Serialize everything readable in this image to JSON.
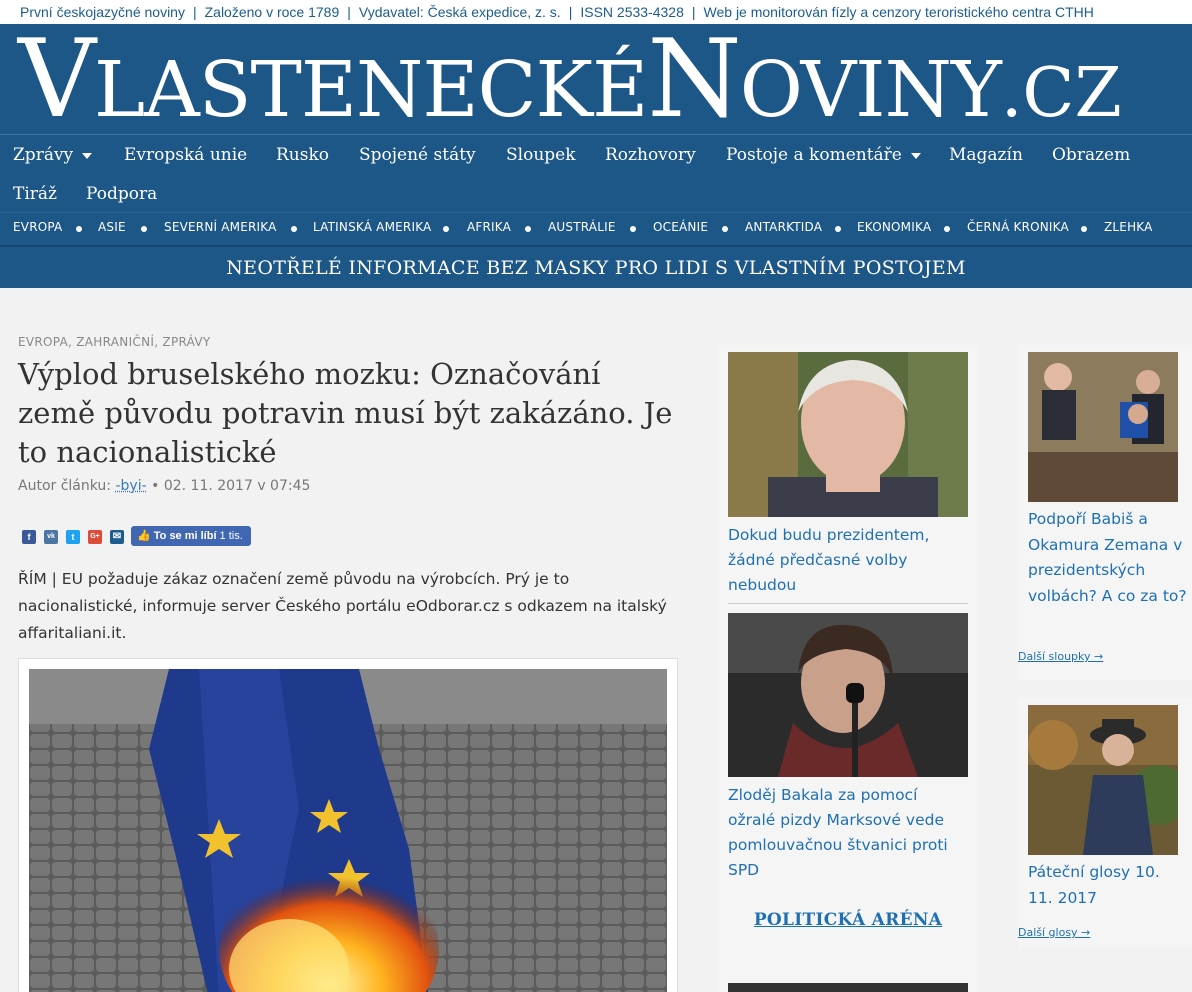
{
  "topbar": {
    "items": [
      "První českojazyčné noviny",
      "Založeno v roce 1789",
      "Vydavatel: Česká expedice, z. s.",
      "ISSN 2533-4328",
      "Web je monitorován fízly a cenzory teroristického centra CTHH"
    ],
    "separator": "|"
  },
  "logo": {
    "v": "V",
    "lastenecke": "LASTENECKÉ",
    "n": "N",
    "oviny": "OVINY",
    "cz": ".CZ"
  },
  "mainnav": {
    "items": [
      {
        "label": "Zprávy",
        "dropdown": true
      },
      {
        "label": "Evropská unie"
      },
      {
        "label": "Rusko"
      },
      {
        "label": "Spojené státy"
      },
      {
        "label": "Sloupek"
      },
      {
        "label": "Rozhovory"
      },
      {
        "label": "Postoje a komentáře",
        "dropdown": true
      },
      {
        "label": "Magazín"
      },
      {
        "label": "Obrazem"
      },
      {
        "label": "Tiráž"
      },
      {
        "label": "Podpora"
      }
    ]
  },
  "regionnav": {
    "items": [
      "EVROPA",
      "ASIE",
      "SEVERNÍ AMERIKA",
      "LATINSKÁ AMERIKA",
      "AFRIKA",
      "AUSTRÁLIE",
      "OCEÁNIE",
      "ANTARKTIDA",
      "EKONOMIKA",
      "ČERNÁ KRONIKA",
      "ZLEHKA"
    ]
  },
  "slogan": "NEOTŘELÉ INFORMACE BEZ MASKY PRO LIDI S VLASTNÍM POSTOJEM",
  "article": {
    "categories": "EVROPA, ZAHRANIČNÍ, ZPRÁVY",
    "title": "Výplod bruselského mozku: Označování země původu potravin musí být zakázáno. Je to nacionalistické",
    "author_prefix": "Autor článku:",
    "author": "-byi-",
    "date": "• 02. 11. 2017 v 07:45",
    "like_label": "To se mi líbí",
    "like_count": "1 tis.",
    "lead": "ŘÍM | EU požaduje zákaz označení země původu na výrobcích. Prý je to nacionalistické, informuje server Českého portálu eOdborar.cz s odkazem na italský affaritaliani.it."
  },
  "share_icons": [
    {
      "name": "facebook-icon",
      "glyph": "f",
      "color": "#3b5998"
    },
    {
      "name": "vk-icon",
      "glyph": "vk",
      "color": "#4c75a3"
    },
    {
      "name": "twitter-icon",
      "glyph": "t",
      "color": "#1da1f2"
    },
    {
      "name": "google-plus-icon",
      "glyph": "G+",
      "color": "#dd4b39"
    },
    {
      "name": "email-icon",
      "glyph": "✉",
      "color": "#1c5d8f"
    }
  ],
  "midcol": {
    "cards": [
      {
        "title": "Dokud budu prezidentem, žádné předčasné volby nebudou"
      },
      {
        "title": "Zloděj Bakala za pomocí ožralé pizdy Marksové vede pomlouvačnou štvanici proti SPD"
      }
    ],
    "arena": "POLITICKÁ ARÉNA"
  },
  "rightcol": {
    "box1": {
      "title": "Podpoří Babiš a Okamura Zemana v prezidentských volbách? A co za to?",
      "more": "Další sloupky →"
    },
    "box2": {
      "title": "Páteční glosy 10. 11. 2017",
      "more": "Další glosy →"
    }
  },
  "colors": {
    "brand_blue": "#1d5787",
    "link_blue": "#1f70b3"
  }
}
